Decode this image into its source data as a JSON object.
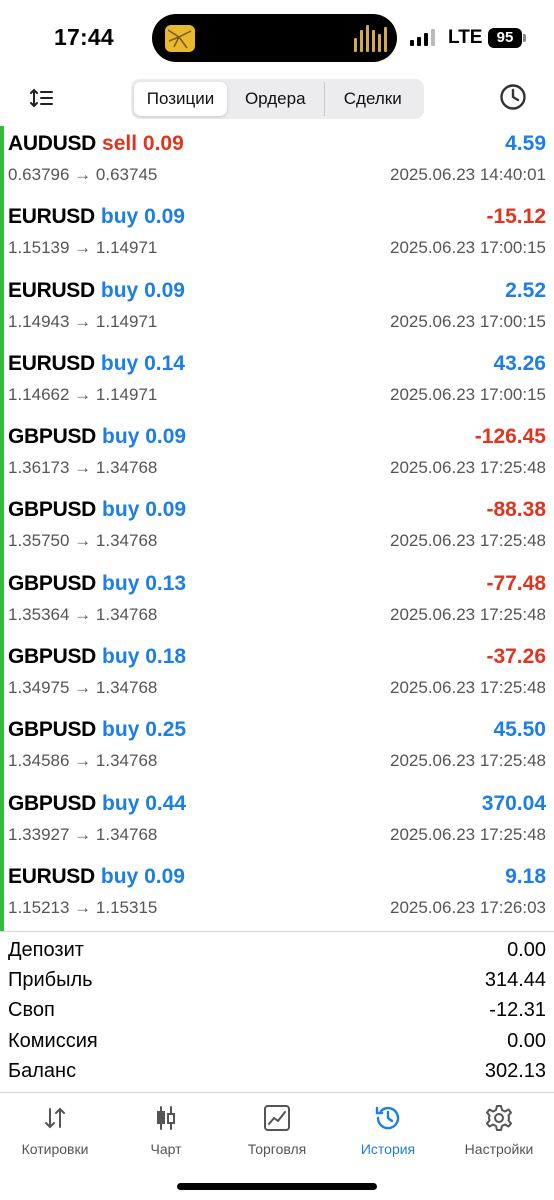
{
  "status_bar": {
    "time": "17:44",
    "network": "LTE",
    "battery": "95"
  },
  "toolbar": {
    "sort_icon": "sort-arrows-icon",
    "tabs": [
      {
        "label": "Позиции",
        "active": true
      },
      {
        "label": "Ордера",
        "active": false
      },
      {
        "label": "Сделки",
        "active": false
      }
    ],
    "history_icon": "clock-icon"
  },
  "colors": {
    "buy": "#1c7ee8",
    "sell": "#e0341f",
    "accent_bar": "#2fbd3b",
    "active_tab": "#1c7ee8"
  },
  "positions": [
    {
      "symbol": "AUDUSD",
      "side": "sell",
      "volume": "0.09",
      "profit": "4.59",
      "prices": "0.63796 → 0.63745",
      "datetime": "2025.06.23 14:40:01"
    },
    {
      "symbol": "EURUSD",
      "side": "buy",
      "volume": "0.09",
      "profit": "-15.12",
      "prices": "1.15139 → 1.14971",
      "datetime": "2025.06.23 17:00:15"
    },
    {
      "symbol": "EURUSD",
      "side": "buy",
      "volume": "0.09",
      "profit": "2.52",
      "prices": "1.14943 → 1.14971",
      "datetime": "2025.06.23 17:00:15"
    },
    {
      "symbol": "EURUSD",
      "side": "buy",
      "volume": "0.14",
      "profit": "43.26",
      "prices": "1.14662 → 1.14971",
      "datetime": "2025.06.23 17:00:15"
    },
    {
      "symbol": "GBPUSD",
      "side": "buy",
      "volume": "0.09",
      "profit": "-126.45",
      "prices": "1.36173 → 1.34768",
      "datetime": "2025.06.23 17:25:48"
    },
    {
      "symbol": "GBPUSD",
      "side": "buy",
      "volume": "0.09",
      "profit": "-88.38",
      "prices": "1.35750 → 1.34768",
      "datetime": "2025.06.23 17:25:48"
    },
    {
      "symbol": "GBPUSD",
      "side": "buy",
      "volume": "0.13",
      "profit": "-77.48",
      "prices": "1.35364 → 1.34768",
      "datetime": "2025.06.23 17:25:48"
    },
    {
      "symbol": "GBPUSD",
      "side": "buy",
      "volume": "0.18",
      "profit": "-37.26",
      "prices": "1.34975 → 1.34768",
      "datetime": "2025.06.23 17:25:48"
    },
    {
      "symbol": "GBPUSD",
      "side": "buy",
      "volume": "0.25",
      "profit": "45.50",
      "prices": "1.34586 → 1.34768",
      "datetime": "2025.06.23 17:25:48"
    },
    {
      "symbol": "GBPUSD",
      "side": "buy",
      "volume": "0.44",
      "profit": "370.04",
      "prices": "1.33927 → 1.34768",
      "datetime": "2025.06.23 17:25:48"
    },
    {
      "symbol": "EURUSD",
      "side": "buy",
      "volume": "0.09",
      "profit": "9.18",
      "prices": "1.15213 → 1.15315",
      "datetime": "2025.06.23 17:26:03"
    }
  ],
  "summary": [
    {
      "label": "Депозит",
      "value": "0.00"
    },
    {
      "label": "Прибыль",
      "value": "314.44"
    },
    {
      "label": "Своп",
      "value": "-12.31"
    },
    {
      "label": "Комиссия",
      "value": "0.00"
    },
    {
      "label": "Баланс",
      "value": "302.13"
    }
  ],
  "tabbar": [
    {
      "label": "Котировки",
      "icon": "quotes-arrows-icon",
      "active": false
    },
    {
      "label": "Чарт",
      "icon": "candlestick-chart-icon",
      "active": false
    },
    {
      "label": "Торговля",
      "icon": "trade-chart-icon",
      "active": false
    },
    {
      "label": "История",
      "icon": "history-clock-icon",
      "active": true
    },
    {
      "label": "Настройки",
      "icon": "gear-icon",
      "active": false
    }
  ]
}
